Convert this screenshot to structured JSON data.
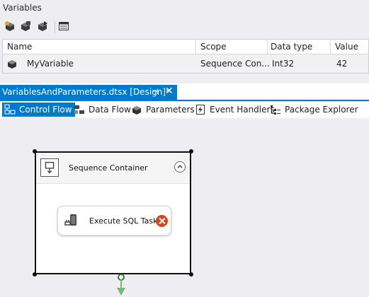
{
  "variables_panel": {
    "title": "Variables",
    "columns": [
      "Name",
      "Scope",
      "Data type",
      "Value"
    ],
    "rows": [
      {
        "name": "MyVariable",
        "scope": "Sequence Con...",
        "data_type": "Int32",
        "value": "42"
      }
    ]
  },
  "document_tab": {
    "title": "VariablesAndParameters.dtsx [Design]*",
    "pin_glyph": "⊣",
    "close_glyph": "✕"
  },
  "designer_tabs": [
    {
      "label": "Control Flow",
      "active": true
    },
    {
      "label": "Data Flow",
      "active": false
    },
    {
      "label": "Parameters",
      "active": false
    },
    {
      "label": "Event Handlers",
      "active": false
    },
    {
      "label": "Package Explorer",
      "active": false
    }
  ],
  "design_surface": {
    "container": {
      "title": "Sequence Container"
    },
    "task": {
      "label": "Execute SQL Task"
    }
  },
  "colors": {
    "accent": "#007acc",
    "error": "#d04a1e",
    "success_connector": "#6fbf73"
  }
}
